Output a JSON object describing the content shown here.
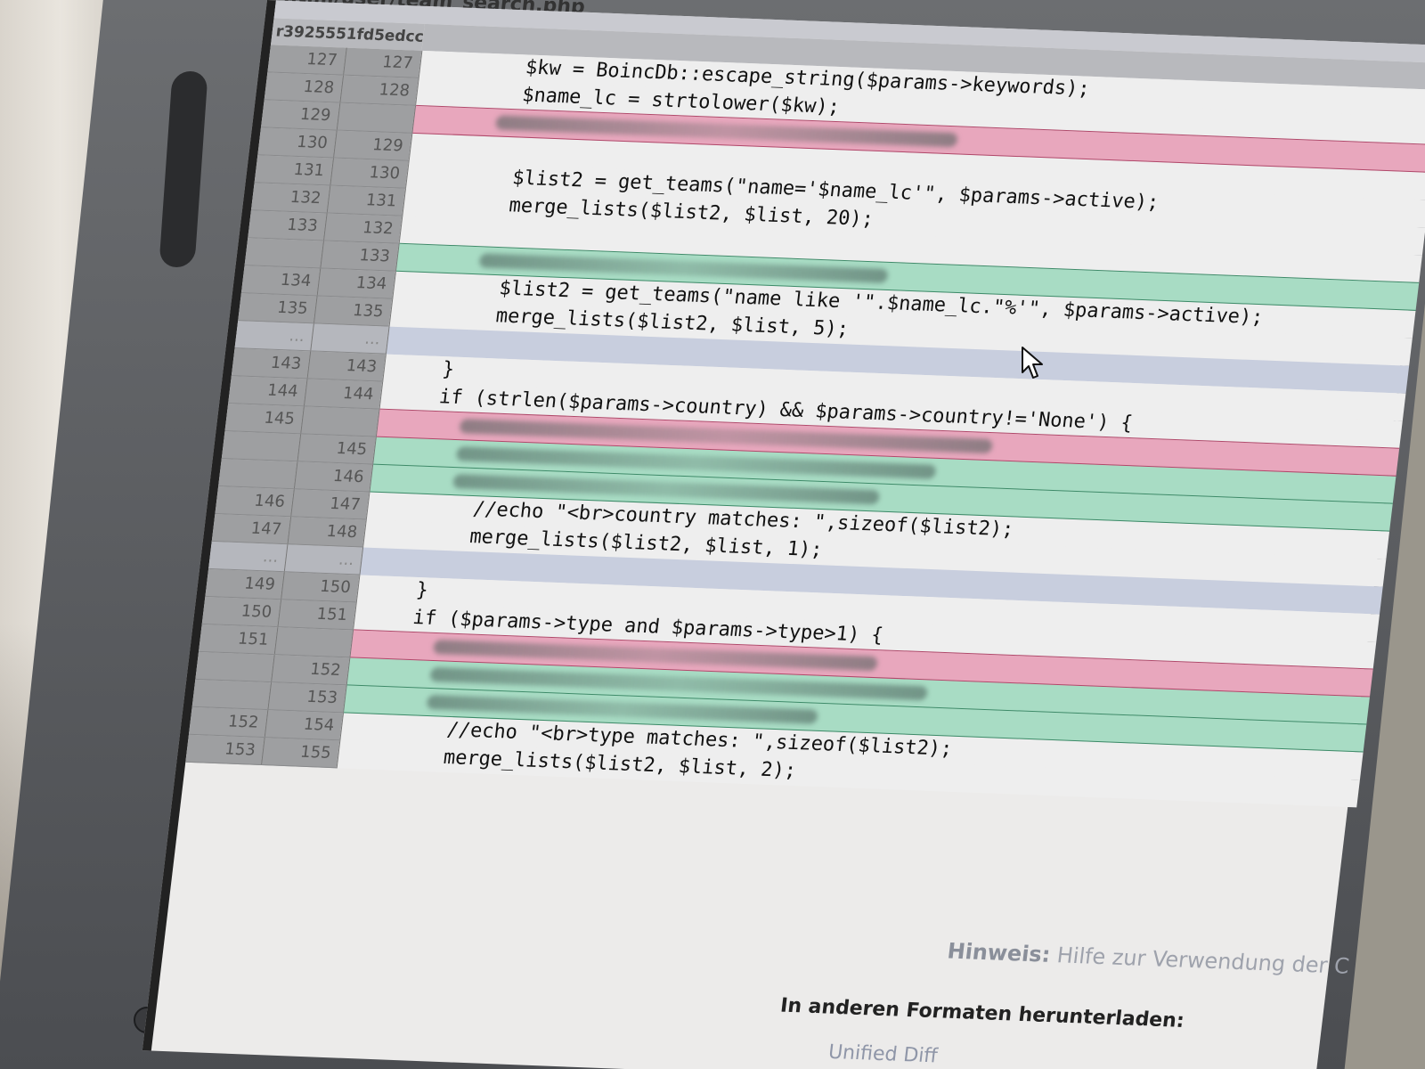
{
  "window": {
    "file_path": "html/user/team_search.php"
  },
  "diff_header": {
    "old_rev": "r392555",
    "new_rev": "1fd5edcc"
  },
  "rows": [
    {
      "type": "ctx",
      "old": "127",
      "new": "127",
      "code": "        $kw = BoincDb::escape_string($params->keywords);"
    },
    {
      "type": "ctx",
      "old": "128",
      "new": "128",
      "code": "        $name_lc = strtolower($kw);"
    },
    {
      "type": "rem",
      "old": "129",
      "new": "",
      "code": ""
    },
    {
      "type": "ctx",
      "old": "130",
      "new": "129",
      "code": ""
    },
    {
      "type": "ctx",
      "old": "131",
      "new": "130",
      "code": "        $list2 = get_teams(\"name='$name_lc'\", $params->active);"
    },
    {
      "type": "ctx",
      "old": "132",
      "new": "131",
      "code": "        merge_lists($list2, $list, 20);"
    },
    {
      "type": "ctx",
      "old": "133",
      "new": "132",
      "code": ""
    },
    {
      "type": "add",
      "old": "",
      "new": "133",
      "code": ""
    },
    {
      "type": "ctx",
      "old": "134",
      "new": "134",
      "code": "        $list2 = get_teams(\"name like '\".$name_lc.\"%'\", $params->active);"
    },
    {
      "type": "ctx",
      "old": "135",
      "new": "135",
      "code": "        merge_lists($list2, $list, 5);"
    },
    {
      "type": "skip",
      "old": "...",
      "new": "...",
      "code": ""
    },
    {
      "type": "ctx",
      "old": "143",
      "new": "143",
      "code": "    }"
    },
    {
      "type": "ctx",
      "old": "144",
      "new": "144",
      "code": "    if (strlen($params->country) && $params->country!='None') {"
    },
    {
      "type": "rem",
      "old": "145",
      "new": "",
      "code": ""
    },
    {
      "type": "add",
      "old": "",
      "new": "145",
      "code": ""
    },
    {
      "type": "add",
      "old": "",
      "new": "146",
      "code": ""
    },
    {
      "type": "ctx",
      "old": "146",
      "new": "147",
      "code": "        //echo \"<br>country matches: \",sizeof($list2);"
    },
    {
      "type": "ctx",
      "old": "147",
      "new": "148",
      "code": "        merge_lists($list2, $list, 1);"
    },
    {
      "type": "skip",
      "old": "...",
      "new": "...",
      "code": ""
    },
    {
      "type": "ctx",
      "old": "149",
      "new": "150",
      "code": "    }"
    },
    {
      "type": "ctx",
      "old": "150",
      "new": "151",
      "code": "    if ($params->type and $params->type>1) {"
    },
    {
      "type": "rem",
      "old": "151",
      "new": "",
      "code": ""
    },
    {
      "type": "add",
      "old": "",
      "new": "152",
      "code": ""
    },
    {
      "type": "add",
      "old": "",
      "new": "153",
      "code": ""
    },
    {
      "type": "ctx",
      "old": "152",
      "new": "154",
      "code": "        //echo \"<br>type matches: \",sizeof($list2);"
    },
    {
      "type": "ctx",
      "old": "153",
      "new": "155",
      "code": "        merge_lists($list2, $list, 2);"
    }
  ],
  "footer": {
    "hint_label": "Hinweis:",
    "hint_text": "Hilfe zur Verwendung der C",
    "formats_label": "In anderen Formaten herunterladen:",
    "unified_diff_link": "Unified Diff"
  },
  "colors": {
    "removed": "#e8a7bd",
    "added": "#a8dcc4",
    "skip": "#c8cede"
  },
  "icons": {
    "cursor": "mouse-pointer-icon"
  }
}
